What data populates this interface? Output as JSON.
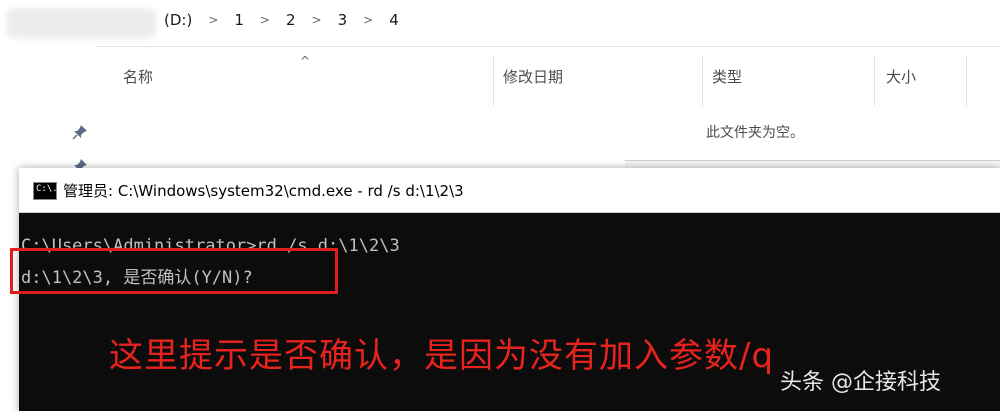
{
  "explorer": {
    "breadcrumb": [
      "(D:)",
      "1",
      "2",
      "3",
      "4"
    ],
    "columns": [
      "名称",
      "修改日期",
      "类型",
      "大小"
    ],
    "empty_message": "此文件夹为空。"
  },
  "cmd": {
    "title": "管理员: C:\\Windows\\system32\\cmd.exe - rd  /s d:\\1\\2\\3",
    "icon_text": "C:\\.",
    "lines": [
      "C:\\Users\\Administrator>rd /s d:\\1\\2\\3",
      "d:\\1\\2\\3, 是否确认(Y/N)?"
    ]
  },
  "annotation": "这里提示是否确认，是因为没有加入参数/q",
  "watermark": "头条 @企接科技"
}
